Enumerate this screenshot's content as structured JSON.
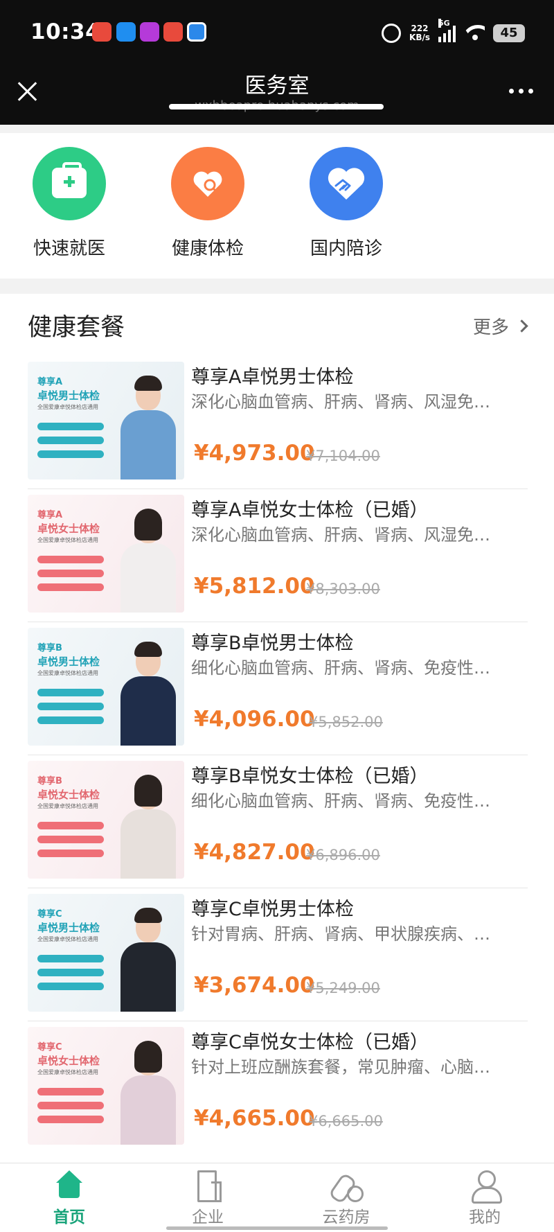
{
  "status_bar": {
    "time": "10:34",
    "net_speed_value": "222",
    "net_speed_unit": "KB/s",
    "network": "5G",
    "battery": "45"
  },
  "header": {
    "title": "医务室",
    "url": "wxhbeapre.huahanys.com"
  },
  "services": [
    {
      "label": "快速就医",
      "icon": "medical-kit-icon",
      "color": "#2dcc86"
    },
    {
      "label": "健康体检",
      "icon": "heart-search-icon",
      "color": "#fb7d44"
    },
    {
      "label": "国内陪诊",
      "icon": "handshake-heart-icon",
      "color": "#3f81ee"
    }
  ],
  "section": {
    "title": "健康套餐",
    "more": "更多"
  },
  "packages": [
    {
      "title": "尊享A卓悦男士体检",
      "desc": "深化心脑血管病、肝病、肾病、风湿免…",
      "price": "¥4,973.00",
      "orig": "¥7,104.00",
      "thumb_tier": "尊享A",
      "thumb_name": "卓悦男士体检",
      "thumb_sub": "全国爱康卓悦体检店通用",
      "gender": "male"
    },
    {
      "title": "尊享A卓悦女士体检（已婚）",
      "desc": "深化心脑血管病、肝病、肾病、风湿免…",
      "price": "¥5,812.00",
      "orig": "¥8,303.00",
      "thumb_tier": "尊享A",
      "thumb_name": "卓悦女士体检",
      "thumb_sub": "全国爱康卓悦体检店通用",
      "gender": "female"
    },
    {
      "title": "尊享B卓悦男士体检",
      "desc": "细化心脑血管病、肝病、肾病、免疫性…",
      "price": "¥4,096.00",
      "orig": "¥5,852.00",
      "thumb_tier": "尊享B",
      "thumb_name": "卓悦男士体检",
      "thumb_sub": "全国爱康卓悦体检店通用",
      "gender": "male"
    },
    {
      "title": "尊享B卓悦女士体检（已婚）",
      "desc": "细化心脑血管病、肝病、肾病、免疫性…",
      "price": "¥4,827.00",
      "orig": "¥6,896.00",
      "thumb_tier": "尊享B",
      "thumb_name": "卓悦女士体检",
      "thumb_sub": "全国爱康卓悦体检店通用",
      "gender": "female"
    },
    {
      "title": "尊享C卓悦男士体检",
      "desc": "针对胃病、肝病、肾病、甲状腺疾病、…",
      "price": "¥3,674.00",
      "orig": "¥5,249.00",
      "thumb_tier": "尊享C",
      "thumb_name": "卓悦男士体检",
      "thumb_sub": "全国爱康卓悦体检店通用",
      "gender": "male"
    },
    {
      "title": "尊享C卓悦女士体检（已婚）",
      "desc": "针对上班应酬族套餐，常见肿瘤、心脑…",
      "price": "¥4,665.00",
      "orig": "¥6,665.00",
      "thumb_tier": "尊享C",
      "thumb_name": "卓悦女士体检",
      "thumb_sub": "全国爱康卓悦体检店通用",
      "gender": "female"
    }
  ],
  "tabs": [
    {
      "label": "首页",
      "icon": "home-icon",
      "active": true
    },
    {
      "label": "企业",
      "icon": "building-icon",
      "active": false
    },
    {
      "label": "云药房",
      "icon": "pill-icon",
      "active": false
    },
    {
      "label": "我的",
      "icon": "user-icon",
      "active": false
    }
  ],
  "colors": {
    "accent_green": "#18a37a",
    "price_orange": "#f07a2c"
  }
}
